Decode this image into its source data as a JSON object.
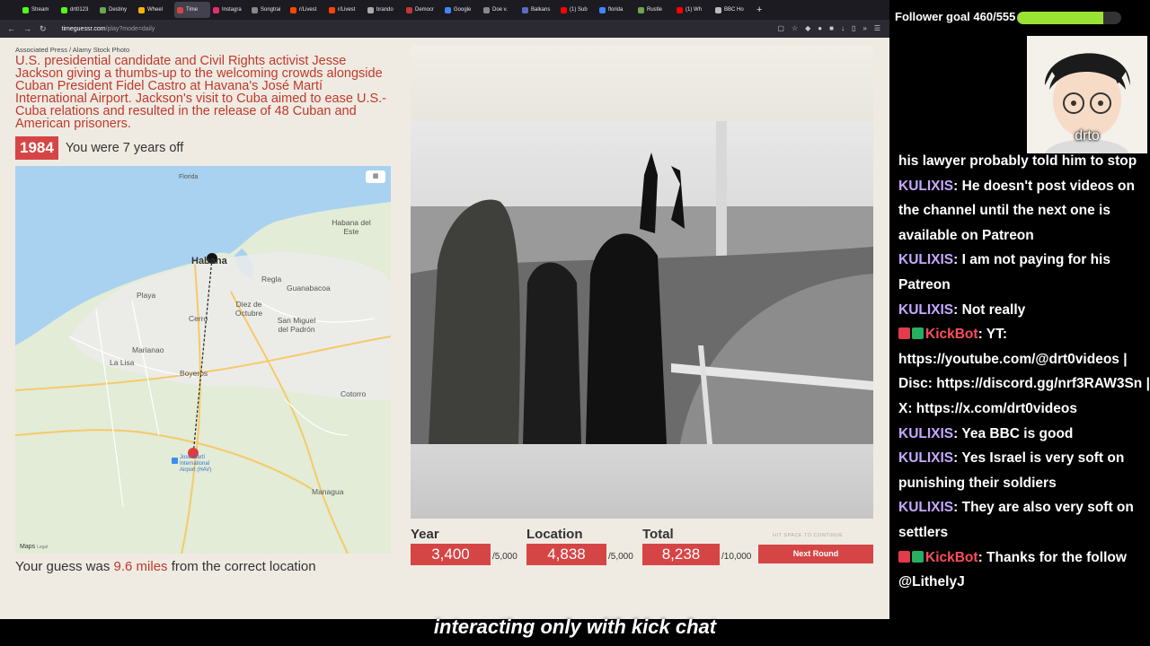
{
  "browser": {
    "tabs": [
      {
        "label": "Stream",
        "color": "#53fc18"
      },
      {
        "label": "drt0123",
        "color": "#53fc18"
      },
      {
        "label": "Destiny",
        "color": "#6aa84f"
      },
      {
        "label": "Wheel",
        "color": "#f4b400"
      },
      {
        "label": "Time",
        "color": "#d64545",
        "active": true
      },
      {
        "label": "Instagra",
        "color": "#e1306c"
      },
      {
        "label": "Songtrai",
        "color": "#888888"
      },
      {
        "label": "r/Livest",
        "color": "#ff4500"
      },
      {
        "label": "r/Livest",
        "color": "#ff4500"
      },
      {
        "label": "brando",
        "color": "#aaaaaa"
      },
      {
        "label": "Democr",
        "color": "#c0392b"
      },
      {
        "label": "Google",
        "color": "#4285f4"
      },
      {
        "label": "Doe v.",
        "color": "#888888"
      },
      {
        "label": "Balkans",
        "color": "#5c6bc0"
      },
      {
        "label": "(1) Sub",
        "color": "#ff0000"
      },
      {
        "label": "florida",
        "color": "#4285f4"
      },
      {
        "label": "Rustle",
        "color": "#6aa84f"
      },
      {
        "label": "(1) Wh",
        "color": "#ff0000"
      },
      {
        "label": "BBC Ho",
        "color": "#bbbbbb"
      }
    ],
    "url_domain": "timeguessr.com",
    "url_path": "/play?mode=daily"
  },
  "result": {
    "credit": "Associated Press / Alamy Stock Photo",
    "caption": "U.S. presidential candidate and Civil Rights activist Jesse Jackson giving a thumbs-up to the welcoming crowds alongside Cuban President Fidel Castro at Havana's José Martí International Airport. Jackson's visit to Cuba aimed to ease U.S.-Cuba relations and resulted in the release of 48 Cuban and American prisoners.",
    "year": "1984",
    "year_off": "You were 7 years off",
    "guess_prefix": "Your guess was ",
    "guess_distance": "9.6 miles",
    "guess_suffix": " from the correct location"
  },
  "map": {
    "labels": {
      "havana": "Habana",
      "habana_del_este": "Habana del Este",
      "playa": "Playa",
      "regla": "Regla",
      "guanabacoa": "Guanabacoa",
      "cerro": "Cerro",
      "diez_de_octubre": "Diez de Octubre",
      "san_miguel": "San Miguel del Padrón",
      "marianao": "Marianao",
      "la_lisa": "La Lisa",
      "boyeros": "Boyeros",
      "cotorro": "Cotorro",
      "airport": "José Martí International Airport (HAV)",
      "managua": "Managua",
      "maps_logo": "Maps",
      "legal": "Legal",
      "florida": "Florida"
    }
  },
  "scores": {
    "year_label": "Year",
    "year_value": "3,400",
    "year_max": "/5,000",
    "location_label": "Location",
    "location_value": "4,838",
    "location_max": "/5,000",
    "total_label": "Total",
    "total_value": "8,238",
    "total_max": "/10,000",
    "hint": "HIT SPACE TO CONTINUE",
    "next_button": "Next Round"
  },
  "stream": {
    "goal_text": "Follower goal 460/555",
    "goal_current": 460,
    "goal_target": 555,
    "cam_name": "drto",
    "subtitle": "interacting only with kick chat",
    "chat": [
      {
        "text": "his lawyer probably told him to stop"
      },
      {
        "user": "KULIXIS",
        "text": "He doesn't post videos on the channel until the next one is available on Patreon"
      },
      {
        "user": "KULIXIS",
        "text": "I am not paying for his Patreon"
      },
      {
        "user": "KULIXIS",
        "text": "Not really"
      },
      {
        "user": "KickBot",
        "bot": true,
        "text": "YT: https://youtube.com/@drt0videos | Disc: https://discord.gg/nrf3RAW3Sn | X: https://x.com/drt0videos"
      },
      {
        "user": "KULIXIS",
        "text": "Yea BBC is good"
      },
      {
        "user": "KULIXIS",
        "text": "Yes Israel is very soft on punishing their soldiers"
      },
      {
        "user": "KULIXIS",
        "text": "They are also very soft on settlers"
      },
      {
        "user": "KickBot",
        "bot": true,
        "text": "Thanks for the follow @LithelyJ"
      }
    ]
  }
}
